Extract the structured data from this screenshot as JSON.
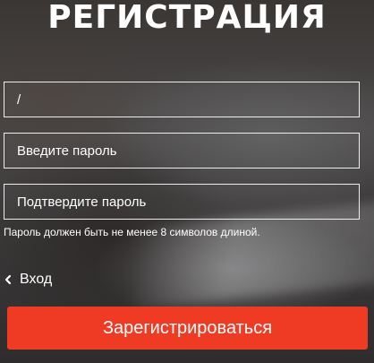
{
  "page": {
    "title": "РЕГИСТРАЦИЯ"
  },
  "form": {
    "login_value": "/",
    "password_placeholder": "Введите пароль",
    "password_confirm_placeholder": "Подтвердите пароль",
    "password_hint": "Пароль должен быть не менее 8 символов длиной.",
    "back_label": "Вход",
    "submit_label": "Зарегистрироваться"
  },
  "colors": {
    "accent": "#ef3a24",
    "text": "#ffffff"
  },
  "icons": {
    "back": "chevron-left-icon"
  }
}
